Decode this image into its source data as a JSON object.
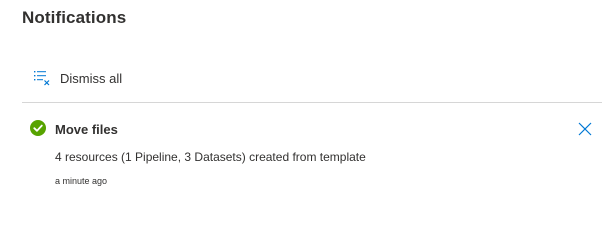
{
  "panel": {
    "title": "Notifications"
  },
  "toolbar": {
    "dismiss_all_label": "Dismiss all",
    "dismiss_all_icon": "dismiss-all-icon"
  },
  "notifications": [
    {
      "status": "success",
      "status_icon": "checkmark-circle-icon",
      "title": "Move files",
      "message": "4 resources (1 Pipeline, 3 Datasets) created from template",
      "time": "a minute ago",
      "close_icon": "close-icon"
    }
  ],
  "colors": {
    "accent": "#0078d4",
    "success": "#57a300",
    "text": "#323130",
    "divider": "#d6d6d6"
  }
}
